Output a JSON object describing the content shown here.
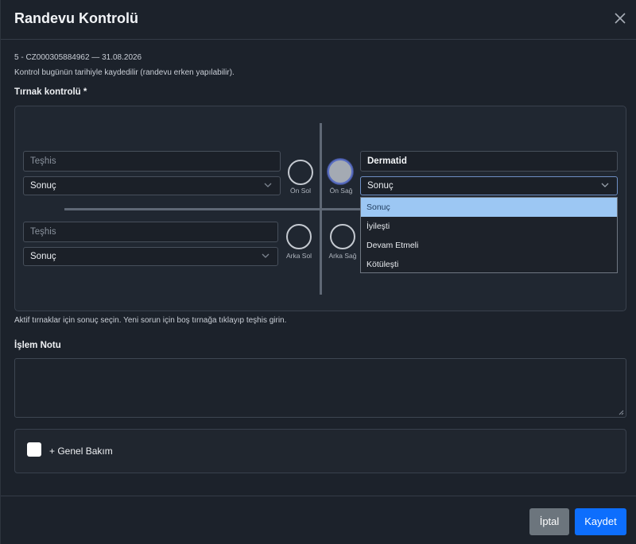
{
  "modal": {
    "title": "Randevu Kontrolü",
    "close_icon": "close-icon"
  },
  "info": {
    "record_line": "5 - CZ000305884962 — 31.08.2026",
    "note_line": "Kontrol bugünün tarihiyle kaydedilir (randevu erken yapılabilir)."
  },
  "nail_control": {
    "label": "Tırnak kontrolü *",
    "front_left": {
      "diagnosis_value": "",
      "diagnosis_placeholder": "Teşhis",
      "result": "Sonuç",
      "nail_label": "Ön Sol",
      "active": false
    },
    "front_right": {
      "diagnosis_value": "Dermatid",
      "diagnosis_placeholder": "Teşhis",
      "result": "Sonuç",
      "nail_label": "Ön Sağ",
      "active": true
    },
    "back_left": {
      "diagnosis_value": "",
      "diagnosis_placeholder": "Teşhis",
      "result": "Sonuç",
      "nail_label": "Arka Sol",
      "active": false
    },
    "back_right": {
      "nail_label": "Arka Sağ",
      "active": false
    },
    "dropdown_options": [
      "Sonuç",
      "İyileşti",
      "Devam Etmeli",
      "Kötüleşti"
    ],
    "dropdown_selected": "Sonuç",
    "hint": "Aktif tırnaklar için sonuç seçin. Yeni sorun için boş tırnağa tıklayıp teşhis girin."
  },
  "process_note": {
    "label": "İşlem Notu",
    "value": ""
  },
  "general_care": {
    "label": "+ Genel Bakım",
    "checked": false
  },
  "footer": {
    "cancel_label": "İptal",
    "save_label": "Kaydet"
  },
  "colors": {
    "primary": "#0d6efd",
    "secondary": "#6c757d",
    "dropdown_highlight": "#9cc7f3"
  }
}
